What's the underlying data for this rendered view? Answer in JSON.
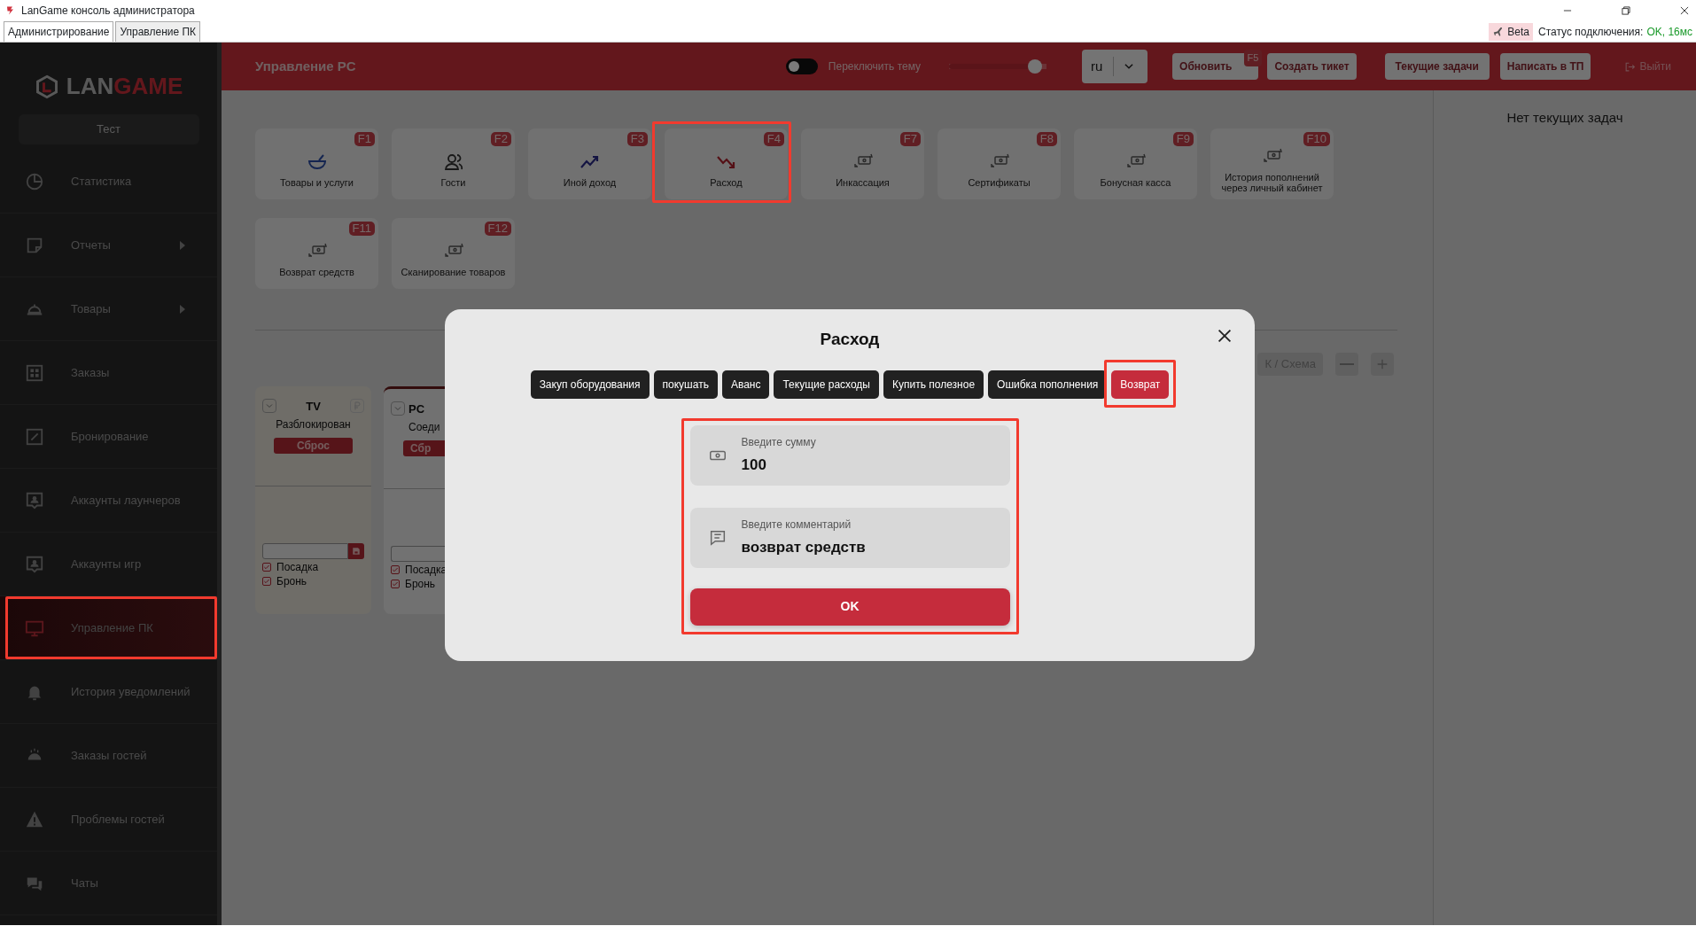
{
  "window": {
    "title": "LanGame консоль администратора"
  },
  "app_tabs": [
    {
      "label": "Администрирование",
      "selected": true
    },
    {
      "label": "Управление ПК",
      "selected": false
    }
  ],
  "connection": {
    "badge": "Beta",
    "label": "Статус подключения:",
    "value": "OK, 16мс"
  },
  "sidebar": {
    "logo_left": "LAN",
    "logo_right": "GAME",
    "club_button": "Тест",
    "items": [
      {
        "label": "Статистика",
        "has_submenu": false,
        "selected": false,
        "highlighted": false
      },
      {
        "label": "Отчеты",
        "has_submenu": true,
        "selected": false,
        "highlighted": false
      },
      {
        "label": "Товары",
        "has_submenu": true,
        "selected": false,
        "highlighted": false
      },
      {
        "label": "Заказы",
        "has_submenu": false,
        "selected": false,
        "highlighted": false
      },
      {
        "label": "Бронирование",
        "has_submenu": false,
        "selected": false,
        "highlighted": false
      },
      {
        "label": "Аккаунты лаунчеров",
        "has_submenu": false,
        "selected": false,
        "highlighted": false
      },
      {
        "label": "Аккаунты игр",
        "has_submenu": false,
        "selected": false,
        "highlighted": false
      },
      {
        "label": "Управление ПК",
        "has_submenu": false,
        "selected": true,
        "highlighted": true
      },
      {
        "label": "История уведомлений",
        "has_submenu": false,
        "selected": false,
        "highlighted": false
      },
      {
        "label": "Заказы гостей",
        "has_submenu": false,
        "selected": false,
        "highlighted": false
      },
      {
        "label": "Проблемы гостей",
        "has_submenu": false,
        "selected": false,
        "highlighted": false
      },
      {
        "label": "Чаты",
        "has_submenu": false,
        "selected": false,
        "highlighted": false
      }
    ]
  },
  "header": {
    "title": "Управление PC",
    "theme_toggle": {
      "label": "Переключить тему",
      "on": false
    },
    "slider": {
      "level": 0.88
    },
    "language": "ru",
    "buttons": [
      {
        "label": "Обновить",
        "hotkey": "F5"
      },
      {
        "label": "Создать тикет"
      },
      {
        "label": "Текущие задачи"
      },
      {
        "label": "Написать в ТП"
      }
    ],
    "logout": "Выйти"
  },
  "tiles": [
    {
      "label": "Товары и услуги",
      "hotkey": "F1",
      "highlighted": false
    },
    {
      "label": "Гости",
      "hotkey": "F2",
      "highlighted": false
    },
    {
      "label": "Иной доход",
      "hotkey": "F3",
      "highlighted": false
    },
    {
      "label": "Расход",
      "hotkey": "F4",
      "highlighted": true
    },
    {
      "label": "Инкассация",
      "hotkey": "F7",
      "highlighted": false
    },
    {
      "label": "Сертификаты",
      "hotkey": "F8",
      "highlighted": false
    },
    {
      "label": "Бонусная касса",
      "hotkey": "F9",
      "highlighted": false
    },
    {
      "label": "История пополнений через личный кабинет",
      "hotkey": "F10",
      "highlighted": false
    },
    {
      "label": "Возврат средств",
      "hotkey": "F11",
      "highlighted": false
    },
    {
      "label": "Сканирование товаров",
      "hotkey": "F12",
      "highlighted": false
    }
  ],
  "toolbar": {
    "view_button": "К / Схема"
  },
  "devices": [
    {
      "kind": "full",
      "name": "TV",
      "status": "Разблокирован",
      "reset": "Сброс",
      "checkboxes": [
        {
          "label": "Посадка",
          "checked": true
        },
        {
          "label": "Бронь",
          "checked": true
        }
      ]
    },
    {
      "kind": "cut",
      "name": "PC",
      "status": "Соеди",
      "reset": "Сбр",
      "checkboxes": [
        {
          "label": "Посадка",
          "checked": true
        },
        {
          "label": "Бронь",
          "checked": true
        }
      ]
    }
  ],
  "right_panel": {
    "empty_text": "Нет текущих задач"
  },
  "modal": {
    "title": "Расход",
    "categories": [
      {
        "label": "Закуп оборудования",
        "selected": false,
        "highlighted": false
      },
      {
        "label": "покушать",
        "selected": false,
        "highlighted": false
      },
      {
        "label": "Аванс",
        "selected": false,
        "highlighted": false
      },
      {
        "label": "Текущие расходы",
        "selected": false,
        "highlighted": false
      },
      {
        "label": "Купить полезное",
        "selected": false,
        "highlighted": false
      },
      {
        "label": "Ошибка пополнения",
        "selected": false,
        "highlighted": false
      },
      {
        "label": "Возврат",
        "selected": true,
        "highlighted": true
      }
    ],
    "form": {
      "highlighted": true,
      "amount": {
        "placeholder": "Введите сумму",
        "value": "100"
      },
      "comment": {
        "placeholder": "Введите комментарий",
        "value": "возврат средств"
      },
      "submit": "OK"
    }
  }
}
